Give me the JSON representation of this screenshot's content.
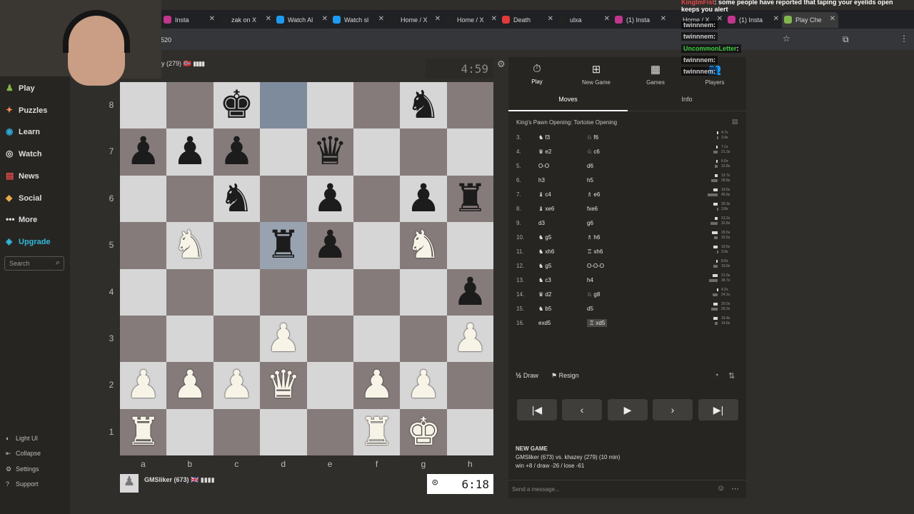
{
  "browser": {
    "tabs": [
      {
        "label": "Insta",
        "color": "#c1358c",
        "active": false
      },
      {
        "label": "zak on X",
        "color": "#222",
        "active": false
      },
      {
        "label": "Watch Al",
        "color": "#1e9bf0",
        "active": false
      },
      {
        "label": "Watch sl",
        "color": "#1e9bf0",
        "active": false
      },
      {
        "label": "Home / X",
        "color": "#222",
        "active": false
      },
      {
        "label": "Home / X",
        "color": "#222",
        "active": false
      },
      {
        "label": "Death",
        "color": "#e03a3a",
        "active": false
      },
      {
        "label": "ulxa",
        "color": "#222",
        "active": false
      },
      {
        "label": "(1) Insta",
        "color": "#c1358c",
        "active": false
      },
      {
        "label": "Home / X",
        "color": "#222",
        "active": false
      },
      {
        "label": "(1) Insta",
        "color": "#c1358c",
        "active": false
      },
      {
        "label": "Play Che",
        "color": "#81b64c",
        "active": true
      }
    ],
    "url_suffix": "520"
  },
  "sidebar": {
    "nav": [
      {
        "label": "Play",
        "icon": "♟",
        "color": "#81b64c"
      },
      {
        "label": "Puzzles",
        "icon": "✦",
        "color": "#f08a4b"
      },
      {
        "label": "Learn",
        "icon": "◉",
        "color": "#2fa8d6"
      },
      {
        "label": "Watch",
        "icon": "◎",
        "color": "#dcdcdc"
      },
      {
        "label": "News",
        "icon": "▤",
        "color": "#e24a4a"
      },
      {
        "label": "Social",
        "icon": "◆",
        "color": "#e8a94a"
      },
      {
        "label": "More",
        "icon": "•••",
        "color": "#dcdcdc"
      },
      {
        "label": "Upgrade",
        "icon": "◈",
        "color": "#32b9dc"
      }
    ],
    "search_placeholder": "Search",
    "bottom": [
      {
        "label": "Light UI",
        "icon": "◐"
      },
      {
        "label": "Collapse",
        "icon": "⇤"
      },
      {
        "label": "Settings",
        "icon": "⚙"
      },
      {
        "label": "Support",
        "icon": "?"
      }
    ]
  },
  "top_player": {
    "name": "y (279)",
    "flag": "🇳🇴",
    "clock": "4:59"
  },
  "bottom_player": {
    "name": "GMSliker (673)",
    "flag": "🇬🇧",
    "clock": "6:18"
  },
  "board": {
    "ranks": [
      "8",
      "7",
      "6",
      "5",
      "4",
      "3",
      "2",
      "1"
    ],
    "files": [
      "a",
      "b",
      "c",
      "d",
      "e",
      "f",
      "g",
      "h"
    ],
    "pieces": [
      {
        "sq": "c8",
        "p": "♚",
        "c": "b"
      },
      {
        "sq": "g8",
        "p": "♞",
        "c": "b"
      },
      {
        "sq": "a7",
        "p": "♟",
        "c": "b"
      },
      {
        "sq": "b7",
        "p": "♟",
        "c": "b"
      },
      {
        "sq": "c7",
        "p": "♟",
        "c": "b"
      },
      {
        "sq": "e7",
        "p": "♛",
        "c": "b"
      },
      {
        "sq": "c6",
        "p": "♞",
        "c": "b"
      },
      {
        "sq": "e6",
        "p": "♟",
        "c": "b"
      },
      {
        "sq": "g6",
        "p": "♟",
        "c": "b"
      },
      {
        "sq": "h6",
        "p": "♜",
        "c": "b"
      },
      {
        "sq": "b5",
        "p": "♞",
        "c": "w"
      },
      {
        "sq": "d5",
        "p": "♜",
        "c": "b"
      },
      {
        "sq": "e5",
        "p": "♟",
        "c": "b"
      },
      {
        "sq": "g5",
        "p": "♞",
        "c": "w"
      },
      {
        "sq": "h4",
        "p": "♟",
        "c": "b"
      },
      {
        "sq": "d3",
        "p": "♟",
        "c": "w"
      },
      {
        "sq": "h3",
        "p": "♟",
        "c": "w"
      },
      {
        "sq": "a2",
        "p": "♟",
        "c": "w"
      },
      {
        "sq": "b2",
        "p": "♟",
        "c": "w"
      },
      {
        "sq": "c2",
        "p": "♟",
        "c": "w"
      },
      {
        "sq": "d2",
        "p": "♛",
        "c": "w"
      },
      {
        "sq": "f2",
        "p": "♟",
        "c": "w"
      },
      {
        "sq": "g2",
        "p": "♟",
        "c": "w"
      },
      {
        "sq": "a1",
        "p": "♜",
        "c": "w"
      },
      {
        "sq": "f1",
        "p": "♜",
        "c": "w"
      },
      {
        "sq": "g1",
        "p": "♚",
        "c": "w"
      }
    ],
    "highlight": [
      "d8",
      "d5"
    ]
  },
  "panel": {
    "tabs": [
      {
        "label": "Play",
        "icon": "⏱"
      },
      {
        "label": "New Game",
        "icon": "⊞"
      },
      {
        "label": "Games",
        "icon": "▦"
      },
      {
        "label": "Players",
        "icon": "👥"
      }
    ],
    "subtabs": [
      "Moves",
      "Info"
    ],
    "opening": "King's Pawn Opening: Tortoise Opening",
    "moves": [
      {
        "n": "3.",
        "w": "♞ f3",
        "b": "♘ f6",
        "tw": "4.7s",
        "tb": "3.4s"
      },
      {
        "n": "4.",
        "w": "♛ e2",
        "b": "♘ c6",
        "tw": "7.1s",
        "tb": "21.3s"
      },
      {
        "n": "5.",
        "w": "O-O",
        "b": "d6",
        "tw": "6.0s",
        "tb": "12.8s"
      },
      {
        "n": "6.",
        "w": "h3",
        "b": "h5",
        "tw": "13.7s",
        "tb": "28.8s"
      },
      {
        "n": "7.",
        "w": "♝ c4",
        "b": "♗ e6",
        "tw": "19.6s",
        "tb": "45.6s"
      },
      {
        "n": "8.",
        "w": "♝ xe6",
        "b": "fxe6",
        "tw": "20.3s",
        "tb": "3.8s"
      },
      {
        "n": "9.",
        "w": "d3",
        "b": "g6",
        "tw": "13.2s",
        "tb": "32.8s"
      },
      {
        "n": "10.",
        "w": "♞ g5",
        "b": "♗ h6",
        "tw": "26.5s",
        "tb": "15.6s"
      },
      {
        "n": "11.",
        "w": "♞ xh6",
        "b": "♖ xh6",
        "tw": "19.6s",
        "tb": "3.9s"
      },
      {
        "n": "12.",
        "w": "♞ g5",
        "b": "O-O-O",
        "tw": "8.0s",
        "tb": "19.9s"
      },
      {
        "n": "13.",
        "w": "♞ c3",
        "b": "h4",
        "tw": "21.5s",
        "tb": "39.7s"
      },
      {
        "n": "14.",
        "w": "♛ d2",
        "b": "♘ g8",
        "tw": "4.2s",
        "tb": "24.1s"
      },
      {
        "n": "15.",
        "w": "♞ b5",
        "b": "d5",
        "tw": "20.0s",
        "tb": "29.2s"
      },
      {
        "n": "16.",
        "w": "exd5",
        "b": "♖ xd5",
        "tw": "19.4s",
        "tb": "14.6s"
      }
    ],
    "draw": "Draw",
    "resign": "Resign",
    "new_game_title": "NEW GAME",
    "new_game_line": "GMSliker (673) vs. khazey (279) (10 min)",
    "new_game_stats": "win +8 / draw -26 / lose -61",
    "chat_placeholder": "Send a message..."
  },
  "stream_chat": [
    {
      "user": "KingImFist",
      "msg": ": some people have reported that taping your eyelids open keeps you alert",
      "color": "#e34848"
    },
    {
      "user": "twinnnem",
      "msg": ":",
      "color": "#cfcfcf"
    },
    {
      "user": "twinnnem",
      "msg": ":",
      "color": "#cfcfcf"
    },
    {
      "user": "UncommonLetter",
      "msg": ":",
      "color": "#3ec93e"
    },
    {
      "user": "twinnnem",
      "msg": ":",
      "color": "#cfcfcf"
    },
    {
      "user": "twinnnem",
      "msg": ":",
      "color": "#cfcfcf"
    }
  ]
}
